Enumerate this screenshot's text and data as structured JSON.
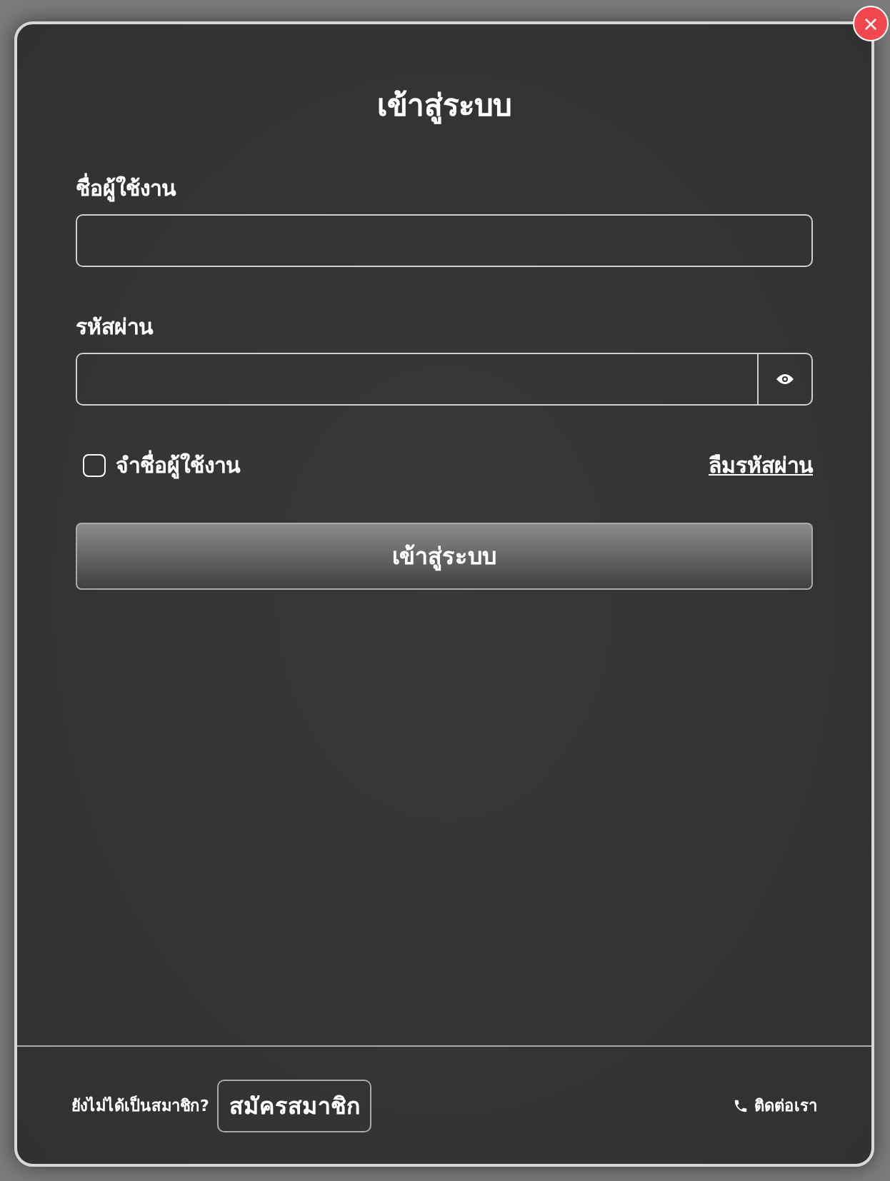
{
  "dialog": {
    "title": "เข้าสู่ระบบ",
    "close_button": "×"
  },
  "username": {
    "label": "ชื่อผู้ใช้งาน"
  },
  "password": {
    "label": "รหัสผ่าน"
  },
  "remember": {
    "label": "จำชื่อผู้ใช้งาน",
    "checked": false
  },
  "forgot_link": "ลืมรหัสผ่าน",
  "login_button": "เข้าสู่ระบบ",
  "footer": {
    "prompt": "ยังไม่ได้เป็นสมาชิก?",
    "register_button": "สมัครสมาชิก",
    "contact": "ติดต่อเรา"
  }
}
